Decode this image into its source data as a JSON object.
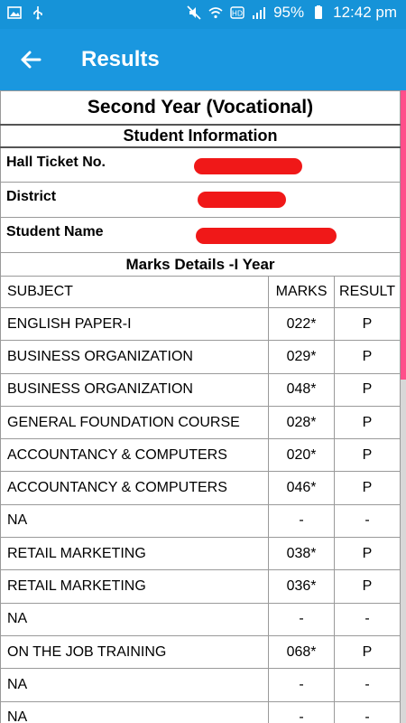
{
  "status_bar": {
    "battery": "95%",
    "time": "12:42 pm",
    "icons": [
      "image-icon",
      "usb-icon",
      "mute-icon",
      "wifi-icon",
      "hd-icon",
      "signal-icon",
      "battery-icon"
    ]
  },
  "app_bar": {
    "back_icon": "arrow-left-icon",
    "title": "Results"
  },
  "colors": {
    "app_bar": "#1a97df",
    "status_bar": "#1693d8",
    "redaction": "#f01818",
    "scroll_indicator": "#ff4f8b"
  },
  "report": {
    "title": "Second Year (Vocational)",
    "student_info_heading": "Student Information",
    "fields": [
      {
        "label": "Hall Ticket No.",
        "value_redacted": true
      },
      {
        "label": "District",
        "value_redacted": true
      },
      {
        "label": "Student Name",
        "value_redacted": true
      }
    ],
    "marks_heading": "Marks Details -I Year",
    "columns": {
      "subject": "SUBJECT",
      "marks": "MARKS",
      "result": "RESULT"
    },
    "rows": [
      {
        "subject": "ENGLISH PAPER-I",
        "marks": "022*",
        "result": "P"
      },
      {
        "subject": "BUSINESS ORGANIZATION",
        "marks": "029*",
        "result": "P"
      },
      {
        "subject": "BUSINESS ORGANIZATION",
        "marks": "048*",
        "result": "P"
      },
      {
        "subject": "GENERAL FOUNDATION COURSE",
        "marks": "028*",
        "result": "P"
      },
      {
        "subject": "ACCOUNTANCY & COMPUTERS",
        "marks": "020*",
        "result": "P"
      },
      {
        "subject": "ACCOUNTANCY & COMPUTERS",
        "marks": "046*",
        "result": "P"
      },
      {
        "subject": "NA",
        "marks": "-",
        "result": "-"
      },
      {
        "subject": "RETAIL MARKETING",
        "marks": "038*",
        "result": "P"
      },
      {
        "subject": "RETAIL MARKETING",
        "marks": "036*",
        "result": "P"
      },
      {
        "subject": "NA",
        "marks": "-",
        "result": "-"
      },
      {
        "subject": "ON THE JOB TRAINING",
        "marks": "068*",
        "result": "P"
      },
      {
        "subject": "NA",
        "marks": "-",
        "result": "-"
      },
      {
        "subject": "NA",
        "marks": "-",
        "result": "-"
      }
    ]
  }
}
